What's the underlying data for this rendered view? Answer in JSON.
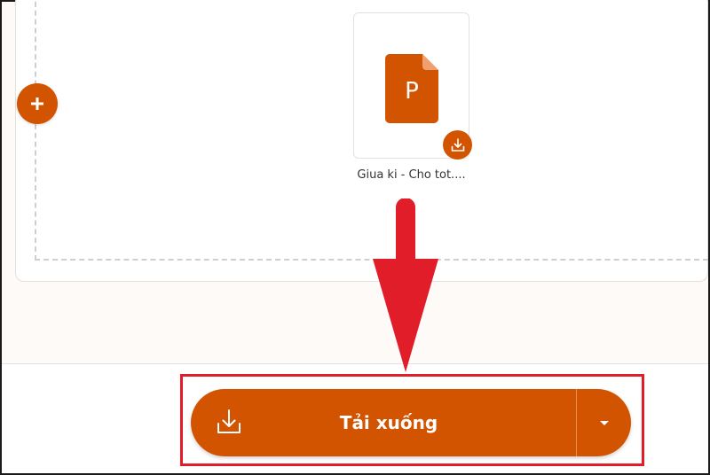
{
  "colors": {
    "accent": "#d35400",
    "annotation_red": "#e11d2a"
  },
  "upload_area": {
    "add_icon": "plus-icon",
    "file": {
      "type_letter": "P",
      "name": "Giua ki - Cho tot....",
      "download_icon": "download-icon"
    }
  },
  "footer": {
    "download_button": {
      "label": "Tải xuống",
      "icon": "download-icon",
      "dropdown_icon": "caret-down-icon"
    }
  }
}
